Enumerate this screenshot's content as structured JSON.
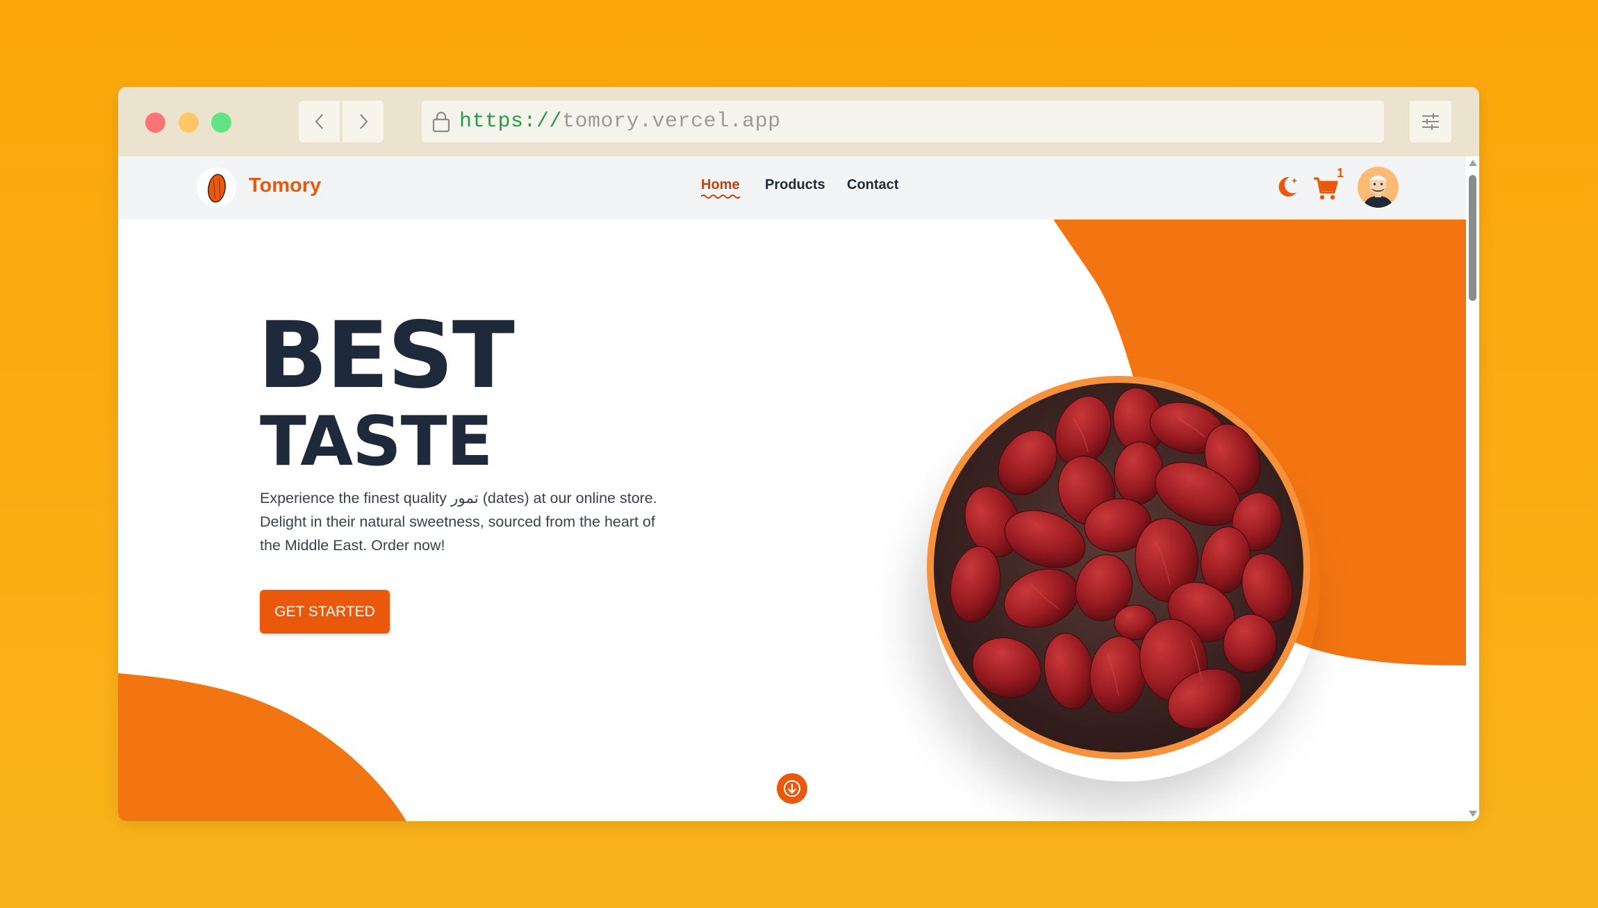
{
  "browser": {
    "url_scheme": "https://",
    "url_host": "tomory.vercel.app",
    "buttons": {
      "back": "back-icon",
      "forward": "forward-icon",
      "settings": "sliders-icon"
    },
    "lock_icon": "lock-icon"
  },
  "site": {
    "brand": "Tomory",
    "nav": {
      "home": "Home",
      "products": "Products",
      "contact": "Contact"
    },
    "cart_count": "1",
    "icons": {
      "theme": "moon-icon",
      "cart": "cart-icon",
      "avatar": "avatar"
    }
  },
  "hero": {
    "title_line1": "BEST",
    "title_line2": "TASTE",
    "description": "Experience the finest quality تمور (dates) at our online store. Delight in their natural sweetness, sourced from the heart of the Middle East. Order now!",
    "cta_label": "GET STARTED",
    "image": "bowl-of-red-dates"
  },
  "colors": {
    "accent": "#ea580c",
    "shape_orange": "#f37512",
    "heading": "#1e293b",
    "background_page": "#fca60b",
    "chrome": "#ebe3cd"
  }
}
